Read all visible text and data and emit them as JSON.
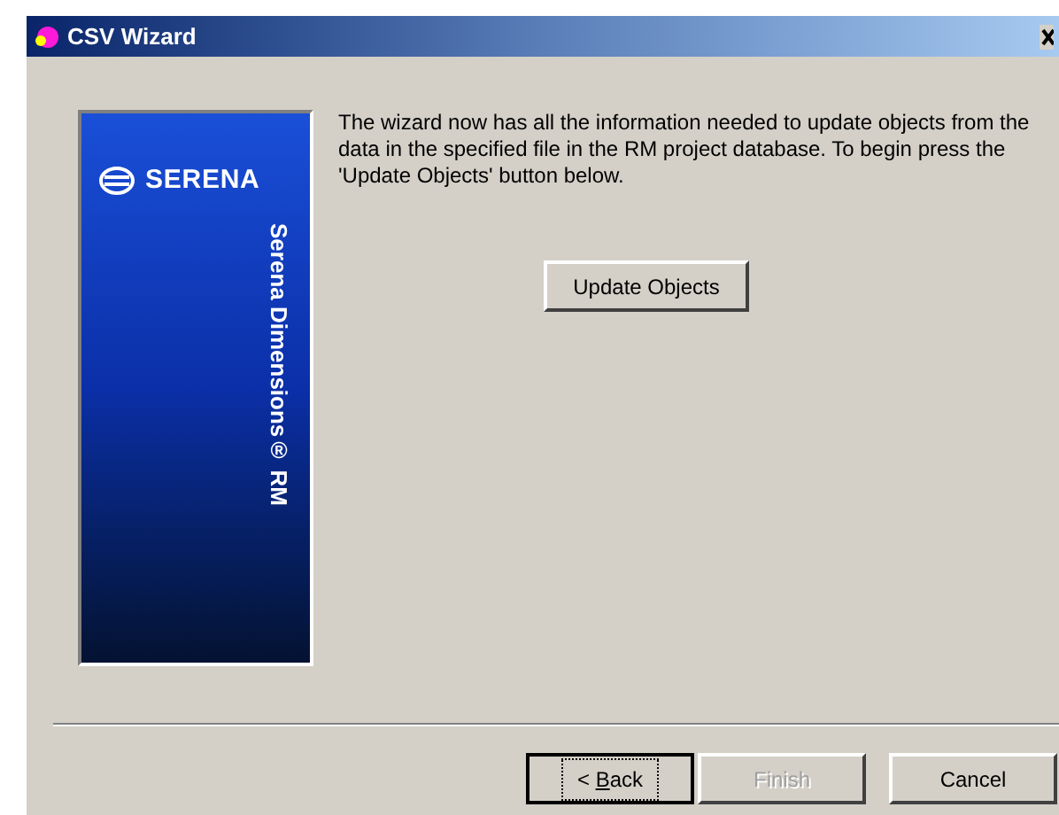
{
  "window": {
    "title": "CSV Wizard"
  },
  "banner": {
    "brand": "SERENA",
    "product": "Serena Dimensions® RM"
  },
  "message": "The wizard now has all the information needed to update objects from the data in the specified file in the RM project database. To begin press the 'Update Objects' button below.",
  "action_button": {
    "label": "Update Objects"
  },
  "buttons": [
    {
      "label_before": "< ",
      "access_key": "B",
      "label_after": "ack",
      "focused": true,
      "disabled": false
    },
    {
      "label_before": "Finish",
      "focused": false,
      "disabled": true
    },
    {
      "label_before": "Cancel",
      "focused": false,
      "disabled": false
    }
  ]
}
